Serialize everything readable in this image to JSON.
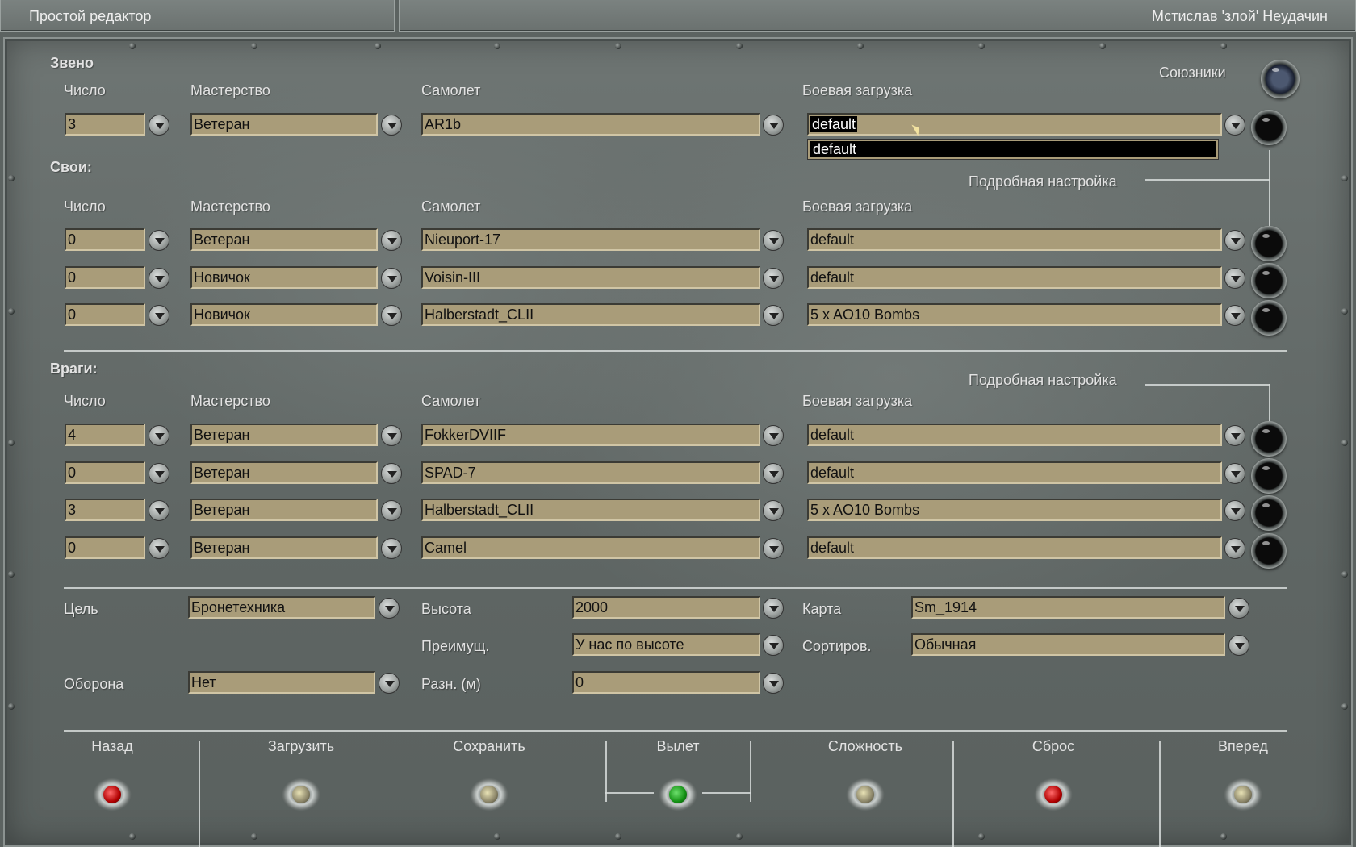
{
  "topbar": {
    "title": "Простой редактор",
    "user": "Мстислав 'злой' Неудачин"
  },
  "headers": {
    "count": "Число",
    "skill": "Мастерство",
    "plane": "Самолет",
    "loadout": "Боевая загрузка"
  },
  "flight": {
    "title": "Звено",
    "allies_label": "Союзники",
    "count": "3",
    "skill": "Ветеран",
    "plane": "AR1b",
    "loadout": "default",
    "dropdown_options": [
      "default"
    ]
  },
  "own": {
    "title": "Свои:",
    "detail_label": "Подробная настройка",
    "rows": [
      {
        "count": "0",
        "skill": "Ветеран",
        "plane": "Nieuport-17",
        "loadout": "default"
      },
      {
        "count": "0",
        "skill": "Новичок",
        "plane": "Voisin-III",
        "loadout": "default"
      },
      {
        "count": "0",
        "skill": "Новичок",
        "plane": "Halberstadt_CLII",
        "loadout": "5 x AO10 Bombs"
      }
    ]
  },
  "enemy": {
    "title": "Враги:",
    "detail_label": "Подробная настройка",
    "rows": [
      {
        "count": "4",
        "skill": "Ветеран",
        "plane": "FokkerDVIIF",
        "loadout": "default"
      },
      {
        "count": "0",
        "skill": "Ветеран",
        "plane": "SPAD-7",
        "loadout": "default"
      },
      {
        "count": "3",
        "skill": "Ветеран",
        "plane": "Halberstadt_CLII",
        "loadout": "5 x AO10 Bombs"
      },
      {
        "count": "0",
        "skill": "Ветеран",
        "plane": "Camel",
        "loadout": "default"
      }
    ]
  },
  "mission": {
    "target_label": "Цель",
    "target_value": "Бронетехника",
    "altitude_label": "Высота",
    "altitude_value": "2000",
    "map_label": "Карта",
    "map_value": "Sm_1914",
    "advantage_label": "Преимущ.",
    "advantage_value": "У  нас по высоте",
    "sort_label": "Сортиров.",
    "sort_value": "Обычная",
    "defense_label": "Оборона",
    "defense_value": "Нет",
    "diff_label": "Разн. (м)",
    "diff_value": "0"
  },
  "bottom": {
    "back": "Назад",
    "load": "Загрузить",
    "save": "Сохранить",
    "fly": "Вылет",
    "difficulty": "Сложность",
    "reset": "Сброс",
    "forward": "Вперед"
  }
}
